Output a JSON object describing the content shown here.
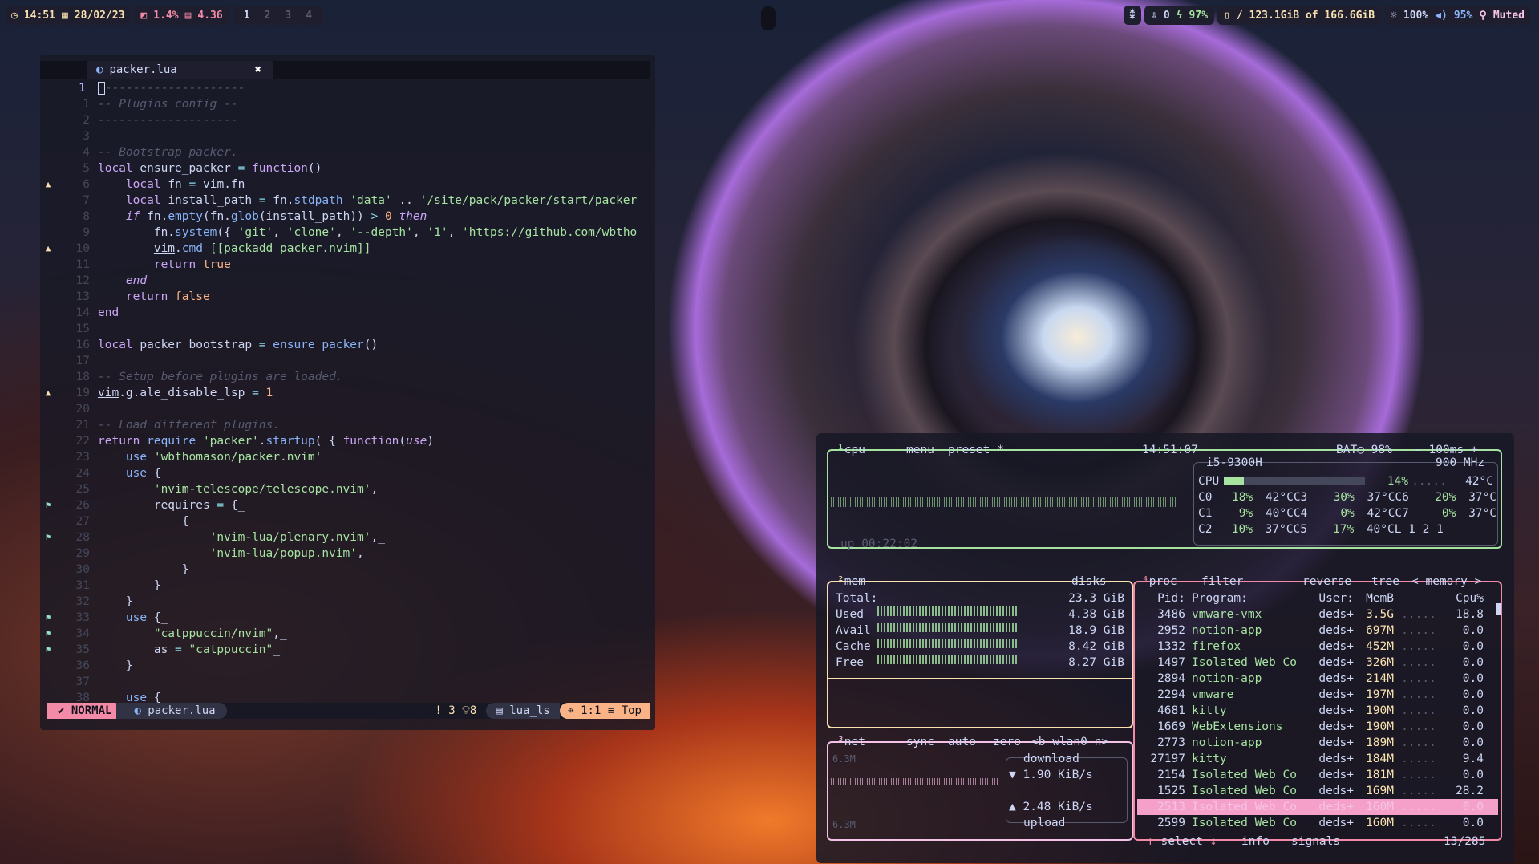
{
  "topbar": {
    "clock": "14:51",
    "date": "28/02/23",
    "cpu": "1.4%",
    "mem": "4.36",
    "workspaces": [
      "1",
      "2",
      "3",
      "4"
    ],
    "bt": "⁑",
    "downloads": "0",
    "battery": "97%",
    "disk": "/ 123.1GiB of 166.6GiB",
    "brightness": "100%",
    "volume": "95%",
    "muted": "Muted"
  },
  "editor": {
    "tab": "packer.lua",
    "lines": [
      {
        "n": "1",
        "sign": "",
        "cur": true
      },
      {
        "n": "1",
        "sign": ""
      },
      {
        "n": "2",
        "sign": ""
      },
      {
        "n": "3",
        "sign": ""
      },
      {
        "n": "4",
        "sign": ""
      },
      {
        "n": "5",
        "sign": ""
      },
      {
        "n": "6",
        "sign": "▲"
      },
      {
        "n": "7",
        "sign": ""
      },
      {
        "n": "8",
        "sign": ""
      },
      {
        "n": "9",
        "sign": ""
      },
      {
        "n": "10",
        "sign": "▲"
      },
      {
        "n": "11",
        "sign": ""
      },
      {
        "n": "12",
        "sign": ""
      },
      {
        "n": "13",
        "sign": ""
      },
      {
        "n": "14",
        "sign": ""
      },
      {
        "n": "15",
        "sign": ""
      },
      {
        "n": "16",
        "sign": ""
      },
      {
        "n": "17",
        "sign": ""
      },
      {
        "n": "18",
        "sign": ""
      },
      {
        "n": "19",
        "sign": "▲"
      },
      {
        "n": "20",
        "sign": ""
      },
      {
        "n": "21",
        "sign": ""
      },
      {
        "n": "22",
        "sign": ""
      },
      {
        "n": "23",
        "sign": ""
      },
      {
        "n": "24",
        "sign": ""
      },
      {
        "n": "25",
        "sign": ""
      },
      {
        "n": "26",
        "sign": "⚑"
      },
      {
        "n": "27",
        "sign": ""
      },
      {
        "n": "28",
        "sign": "⚑"
      },
      {
        "n": "29",
        "sign": ""
      },
      {
        "n": "30",
        "sign": ""
      },
      {
        "n": "31",
        "sign": ""
      },
      {
        "n": "32",
        "sign": ""
      },
      {
        "n": "33",
        "sign": "⚑"
      },
      {
        "n": "34",
        "sign": "⚑"
      },
      {
        "n": "35",
        "sign": "⚑"
      },
      {
        "n": "36",
        "sign": ""
      },
      {
        "n": "37",
        "sign": ""
      },
      {
        "n": "38",
        "sign": ""
      }
    ],
    "status": {
      "mode": "NORMAL",
      "file": "packer.lua",
      "warn": "3",
      "hint": "8",
      "lsp": "lua_ls",
      "pos": "1:1",
      "scroll": "Top"
    }
  },
  "btop": {
    "cpu": {
      "title": "cpu",
      "menu": "menu",
      "preset": "preset *",
      "time": "14:51:07",
      "bat": "BAT○ 98%",
      "rate": "- 100ms +",
      "model": "i5-9300H",
      "freq": "900 MHz",
      "total_label": "CPU",
      "total": "14%",
      "total_temp": "42°C",
      "uptime": "up 00:22:02",
      "cores": [
        [
          "C0",
          "18%",
          "42°C",
          "C3",
          "30%",
          "37°C",
          "C6",
          "20%",
          "37°C"
        ],
        [
          "C1",
          "9%",
          "40°C",
          "C4",
          "0%",
          "42°C",
          "C7",
          "0%",
          "37°C"
        ],
        [
          "C2",
          "10%",
          "37°C",
          "C5",
          "17%",
          "40°C",
          "L 1 2 1",
          "",
          " "
        ]
      ]
    },
    "mem": {
      "title": "mem",
      "disks": "disks",
      "total_label": "Total:",
      "total": "23.3 GiB",
      "rows": [
        [
          "Used",
          "4.38 GiB"
        ],
        [
          "Avail",
          "18.9 GiB"
        ],
        [
          "Cache",
          "8.42 GiB"
        ],
        [
          "Free",
          "8.27 GiB"
        ]
      ]
    },
    "net": {
      "title": "net",
      "sync": "sync",
      "auto": "auto",
      "zero": "zero",
      "iface": "<b wlan0 n>",
      "top": "6.3M",
      "bot": "6.3M",
      "download_label": "download",
      "download": "1.90 KiB/s",
      "upload": "2.48 KiB/s",
      "upload_label": "upload"
    },
    "proc": {
      "title": "proc",
      "filter": "filter",
      "reverse": "reverse",
      "tree": "tree",
      "sort": "< memory >",
      "headers": [
        "Pid:",
        "Program:",
        "User:",
        "MemB",
        "Cpu%"
      ],
      "rows": [
        [
          "3486",
          "vmware-vmx",
          "deds+",
          "3.5G",
          "18.8"
        ],
        [
          "2952",
          "notion-app",
          "deds+",
          "697M",
          "0.0"
        ],
        [
          "1332",
          "firefox",
          "deds+",
          "452M",
          "0.0"
        ],
        [
          "1497",
          "Isolated Web Co",
          "deds+",
          "326M",
          "0.0"
        ],
        [
          "2894",
          "notion-app",
          "deds+",
          "214M",
          "0.0"
        ],
        [
          "2294",
          "vmware",
          "deds+",
          "197M",
          "0.0"
        ],
        [
          "4681",
          "kitty",
          "deds+",
          "190M",
          "0.0"
        ],
        [
          "1669",
          "WebExtensions",
          "deds+",
          "190M",
          "0.0"
        ],
        [
          "2773",
          "notion-app",
          "deds+",
          "189M",
          "0.0"
        ],
        [
          "27197",
          "kitty",
          "deds+",
          "184M",
          "9.4"
        ],
        [
          "2154",
          "Isolated Web Co",
          "deds+",
          "181M",
          "0.0"
        ],
        [
          "1525",
          "Isolated Web Co",
          "deds+",
          "169M",
          "28.2"
        ],
        [
          "2513",
          "Isolated Web Co",
          "deds+",
          "160M",
          "0.0"
        ],
        [
          "2599",
          "Isolated Web Co",
          "deds+",
          "160M",
          "0.0"
        ]
      ],
      "selected": 12,
      "select": "select",
      "info": "info",
      "signals": "signals",
      "count": "13/285"
    }
  }
}
